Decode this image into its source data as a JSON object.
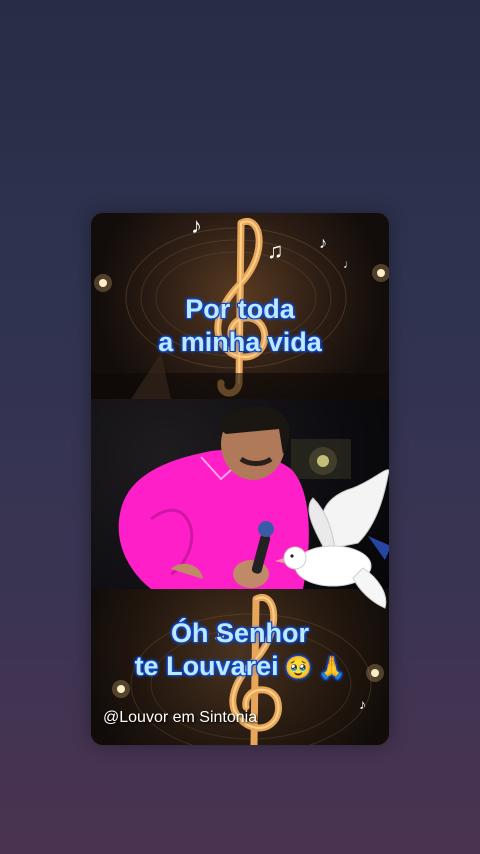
{
  "video": {
    "caption_top": {
      "line1": "Por toda",
      "line2": "a minha vida"
    },
    "caption_bottom": {
      "line1": "Óh Senhor",
      "line2": "te Louvarei",
      "emoji1": "🥹",
      "emoji2": "🙏"
    },
    "watermark": "@Louvor em Sintonia"
  },
  "colors": {
    "background_top": "#272d45",
    "background_bottom": "#4a3350",
    "caption_text": "#bfe9ff",
    "caption_glow": "#1a63ff",
    "singer_shirt": "#ff1fc8"
  },
  "icons": {
    "treble_clef": "treble-clef-icon",
    "music_notes": "music-note-icon",
    "dove": "dove-icon"
  }
}
